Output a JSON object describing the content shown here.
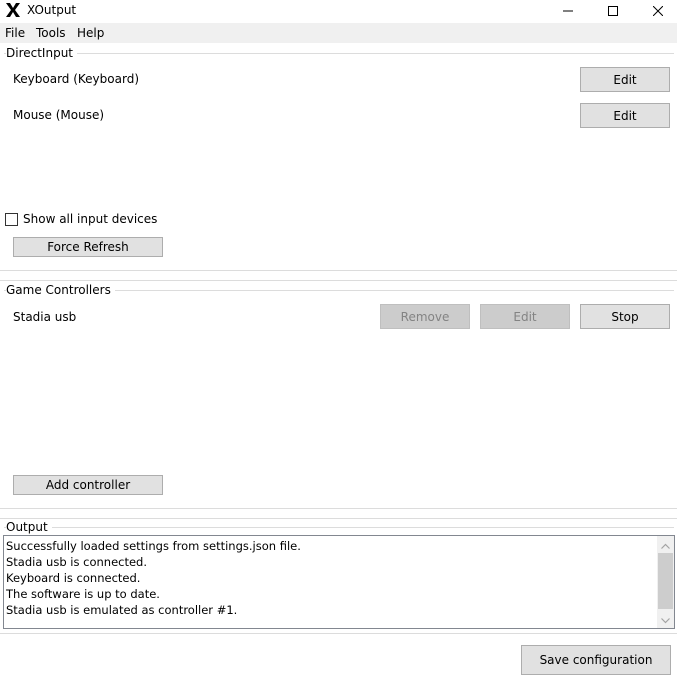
{
  "window": {
    "title": "XOutput"
  },
  "menu": {
    "items": [
      "File",
      "Tools",
      "Help"
    ]
  },
  "direct_input": {
    "group_title": "DirectInput",
    "devices": [
      {
        "name": "Keyboard (Keyboard)",
        "edit_label": "Edit"
      },
      {
        "name": "Mouse (Mouse)",
        "edit_label": "Edit"
      }
    ],
    "show_all_label": "Show all input devices",
    "show_all_checked": false,
    "force_refresh_label": "Force Refresh"
  },
  "game_controllers": {
    "group_title": "Game Controllers",
    "controllers": [
      {
        "name": "Stadia usb",
        "remove_label": "Remove",
        "edit_label": "Edit",
        "stop_label": "Stop"
      }
    ],
    "add_controller_label": "Add controller"
  },
  "output": {
    "group_title": "Output",
    "lines": [
      "Successfully loaded settings from settings.json file.",
      "Stadia usb is connected.",
      "Keyboard is connected.",
      "The software is up to date.",
      "Stadia usb is emulated as controller #1."
    ]
  },
  "footer": {
    "save_label": "Save configuration"
  },
  "icons": {
    "app": "xoutput-x-icon",
    "minimize": "minimize-icon",
    "maximize": "maximize-icon",
    "close": "close-icon"
  }
}
